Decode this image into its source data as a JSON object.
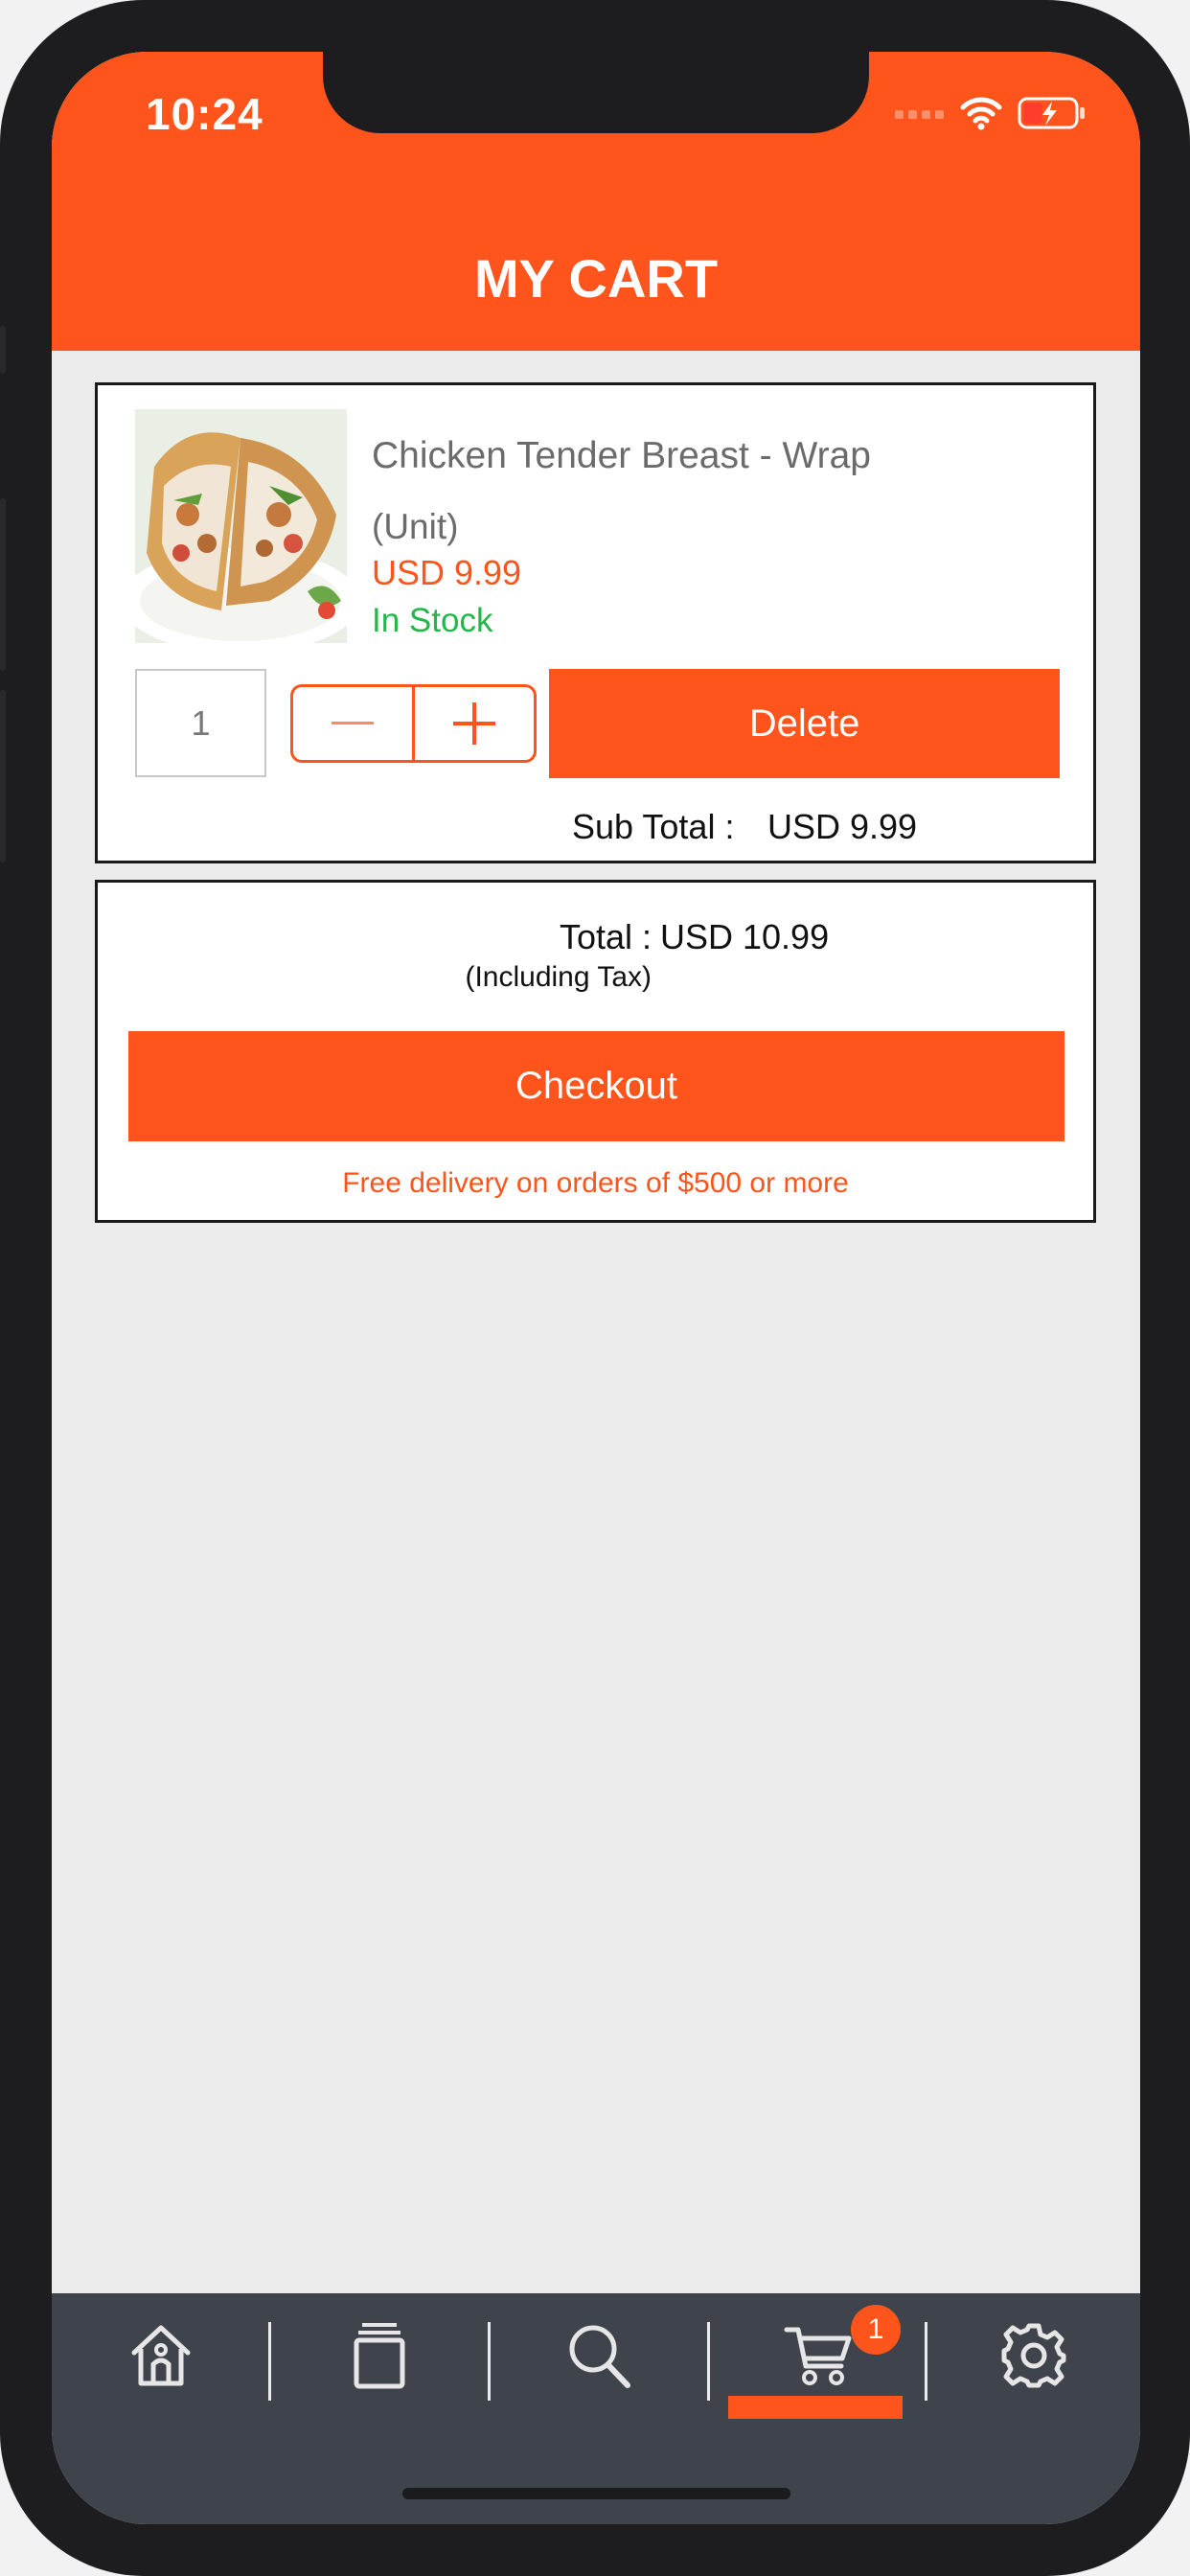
{
  "status_bar": {
    "time": "10:24"
  },
  "header": {
    "title": "MY CART"
  },
  "cart_item": {
    "name": "Chicken Tender Breast - Wrap",
    "unit": "(Unit)",
    "price": "USD 9.99",
    "stock": "In Stock",
    "quantity": "1",
    "delete_label": "Delete",
    "subtotal_label": "Sub Total :",
    "subtotal_value": "USD 9.99"
  },
  "summary": {
    "total_label": "Total :",
    "tax_note": "(Including Tax)",
    "total_value": "USD 10.99",
    "checkout_label": "Checkout",
    "promo": "Free delivery on orders of $500 or more"
  },
  "tabbar": {
    "items": [
      {
        "icon": "home-icon"
      },
      {
        "icon": "catalog-icon"
      },
      {
        "icon": "search-icon"
      },
      {
        "icon": "cart-icon",
        "badge": "1",
        "active": true
      },
      {
        "icon": "gear-icon"
      }
    ]
  },
  "colors": {
    "accent": "#ff541b",
    "stock": "#21b84a",
    "tabbar": "#3f434c"
  }
}
